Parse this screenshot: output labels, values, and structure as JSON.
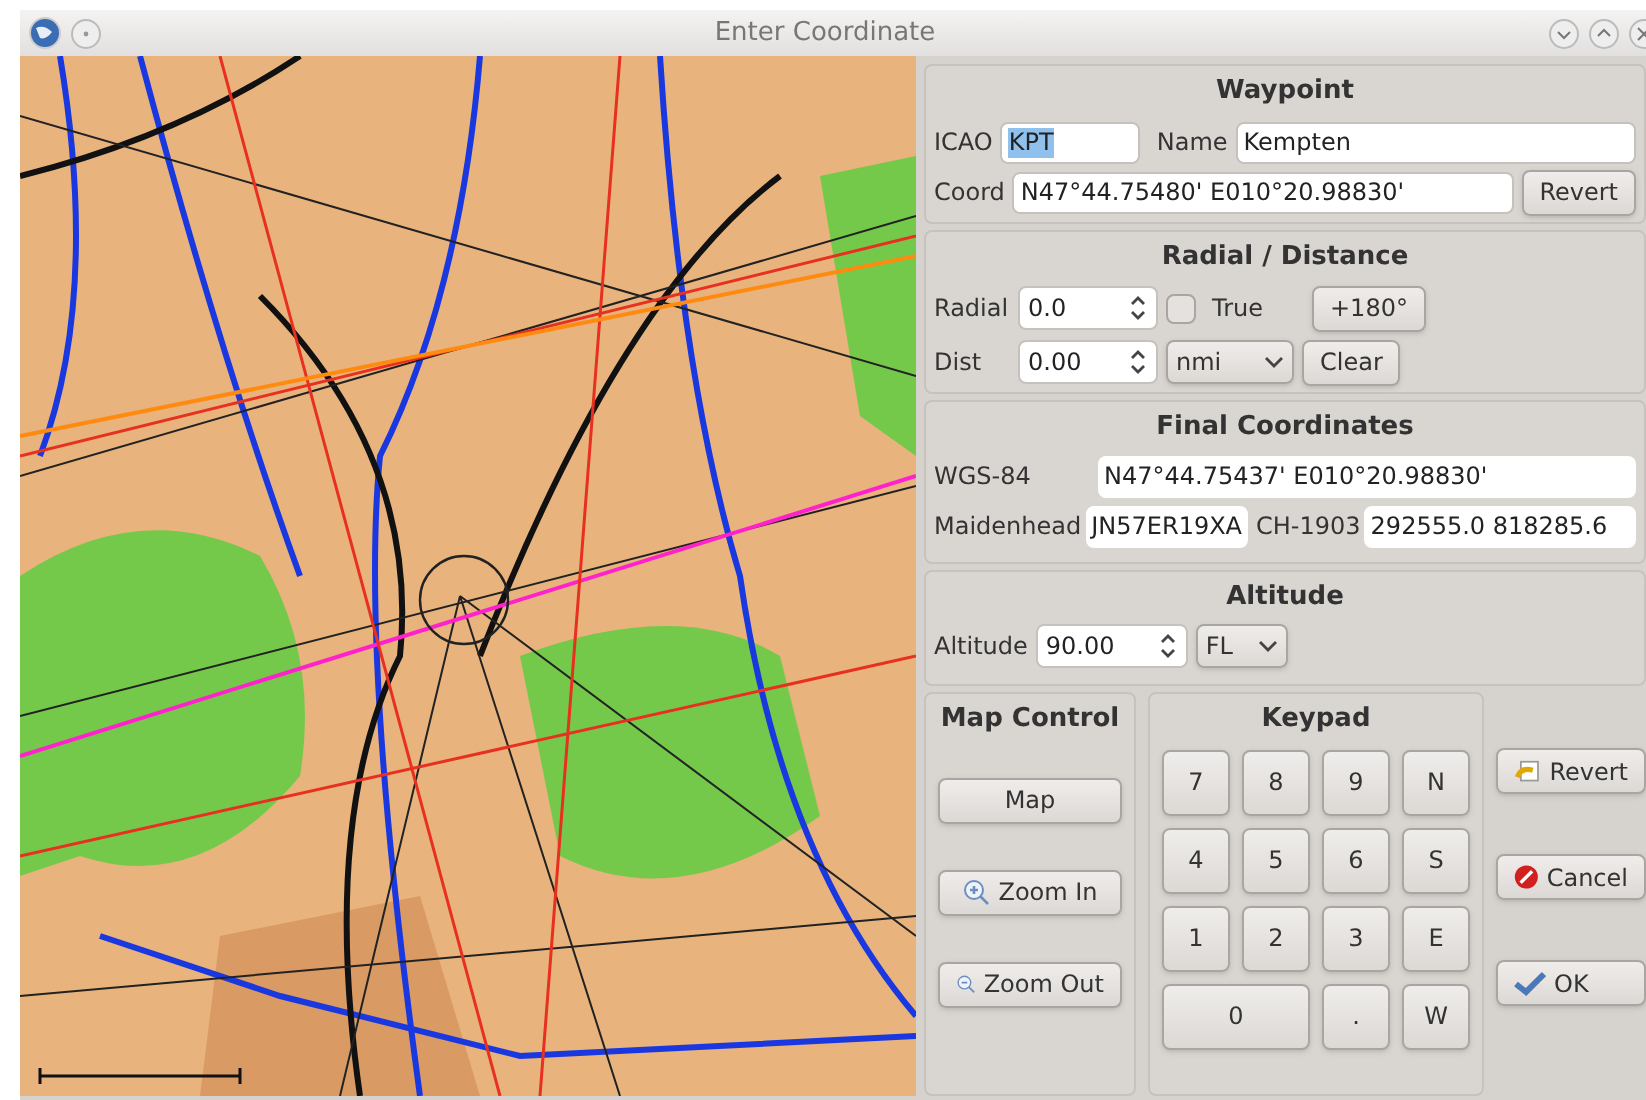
{
  "window": {
    "title": "Enter Coordinate"
  },
  "waypoint": {
    "title": "Waypoint",
    "icao": {
      "label": "ICAO",
      "value": "KPT",
      "selected": true
    },
    "name": {
      "label": "Name",
      "value": "Kempten"
    },
    "coord": {
      "label": "Coord",
      "value": "N47°44.75480' E010°20.98830'"
    },
    "revert": "Revert"
  },
  "radial_distance": {
    "title": "Radial / Distance",
    "radial": {
      "label": "Radial",
      "value": "0.0"
    },
    "true_checkbox": {
      "label": "True",
      "checked": false
    },
    "flip": "+180°",
    "dist": {
      "label": "Dist",
      "value": "0.00"
    },
    "unit": "nmi",
    "clear": "Clear"
  },
  "final_coordinates": {
    "title": "Final Coordinates",
    "wgs84": {
      "label": "WGS-84",
      "value": "N47°44.75437' E010°20.98830'"
    },
    "maidenhead": {
      "label": "Maidenhead",
      "value": "JN57ER19XA"
    },
    "ch1903": {
      "label": "CH-1903",
      "value": "292555.0 818285.6"
    }
  },
  "altitude": {
    "title": "Altitude",
    "label": "Altitude",
    "value": "90.00",
    "unit": "FL"
  },
  "map_control": {
    "title": "Map Control",
    "buttons": [
      {
        "label": "Map",
        "kind": "plain"
      },
      {
        "label": "Zoom In",
        "kind": "zoom_in"
      },
      {
        "label": "Zoom Out",
        "kind": "zoom_out"
      }
    ]
  },
  "keypad": {
    "title": "Keypad",
    "keys": [
      {
        "label": "7",
        "kind": "normal"
      },
      {
        "label": "8",
        "kind": "normal"
      },
      {
        "label": "9",
        "kind": "normal"
      },
      {
        "label": "N",
        "kind": "normal"
      },
      {
        "label": "4",
        "kind": "normal"
      },
      {
        "label": "5",
        "kind": "normal"
      },
      {
        "label": "6",
        "kind": "normal"
      },
      {
        "label": "S",
        "kind": "normal"
      },
      {
        "label": "1",
        "kind": "normal"
      },
      {
        "label": "2",
        "kind": "normal"
      },
      {
        "label": "3",
        "kind": "normal"
      },
      {
        "label": "E",
        "kind": "normal"
      },
      {
        "label": "0",
        "kind": "wide"
      },
      {
        "label": ".",
        "kind": "normal"
      },
      {
        "label": "W",
        "kind": "normal"
      }
    ]
  },
  "actions": [
    {
      "label": "Revert",
      "kind": "revert"
    },
    {
      "label": "Cancel",
      "kind": "cancel"
    },
    {
      "label": "OK",
      "kind": "ok"
    }
  ]
}
